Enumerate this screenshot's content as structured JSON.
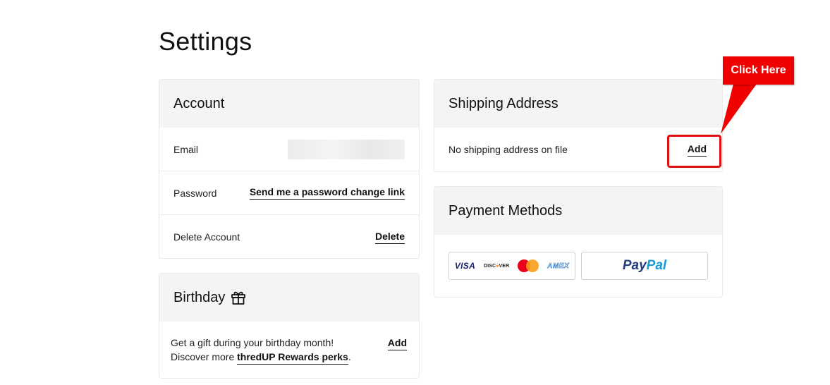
{
  "page": {
    "title": "Settings"
  },
  "account": {
    "title": "Account",
    "email": {
      "label": "Email",
      "value_redacted": true
    },
    "password": {
      "label": "Password",
      "action": "Send me a password change link"
    },
    "delete": {
      "label": "Delete Account",
      "action": "Delete"
    }
  },
  "birthday": {
    "title": "Birthday",
    "icon": "gift-icon",
    "line1": "Get a gift during your birthday month!",
    "line2_prefix": "Discover more ",
    "rewards_link": "thredUP Rewards perks",
    "line2_suffix": ".",
    "action": "Add"
  },
  "shipping": {
    "title": "Shipping Address",
    "status": "No shipping address on file",
    "action": "Add"
  },
  "payment": {
    "title": "Payment Methods",
    "cards": {
      "visa": "VISA",
      "discover_a": "DISC",
      "discover_o": "O",
      "discover_b": "VER",
      "mastercard": "mastercard",
      "amex": "AMEX"
    },
    "paypal": {
      "part1": "Pay",
      "part2": "Pal"
    }
  },
  "annotation": {
    "callout_text": "Click Here",
    "color": "#f10000"
  }
}
